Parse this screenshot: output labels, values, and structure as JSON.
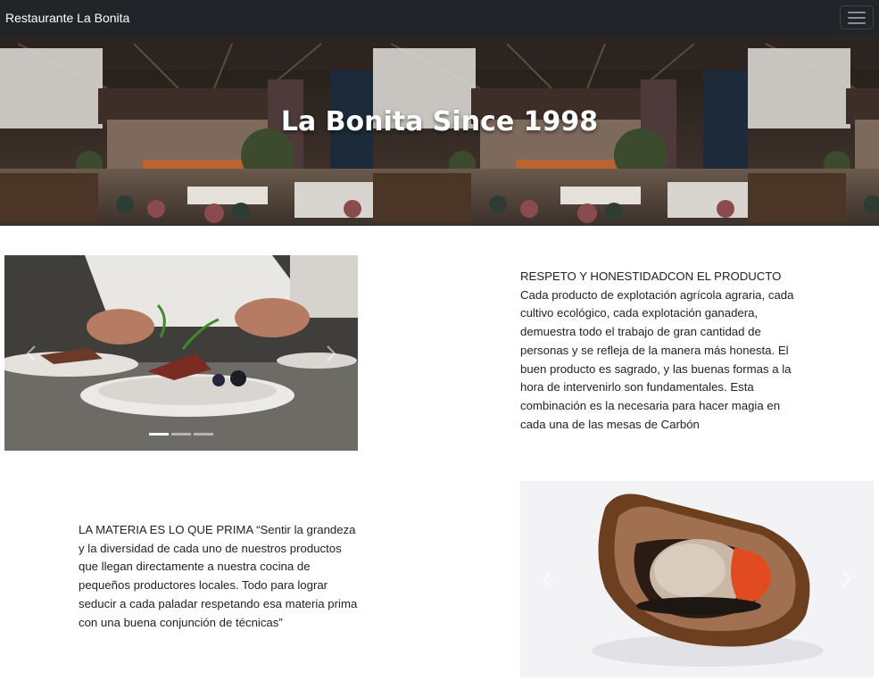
{
  "navbar": {
    "brand": "Restaurante La Bonita",
    "toggler_icon": "hamburger-menu-icon"
  },
  "hero": {
    "title": "La Bonita Since 1998"
  },
  "section1": {
    "carousel": {
      "prev_icon": "chevron-left-icon",
      "next_icon": "chevron-right-icon",
      "indicators": 3,
      "active_index": 0
    },
    "text": "RESPETO Y HONESTIDADCON EL PRODUCTO Cada producto de explotación agrícola agraria, cada cultivo ecológico, cada explotación ganadera, demuestra todo el trabajo de gran cantidad de personas y se refleja de la manera más honesta. El buen producto es sagrado, y las buenas formas a la hora de intervenirlo son fundamentales. Esta combinación es la necesaria para hacer magia en cada una de las mesas de Carbón"
  },
  "section2": {
    "text": "LA MATERIA ES LO QUE PRIMA “Sentir la grandeza y la diversidad de cada uno de nuestros productos que llegan directamente a nuestra cocina de pequeños productores locales. Todo para lograr seducir a cada paladar respetando esa materia prima con una buena conjunción de técnicas”",
    "carousel": {
      "prev_icon": "chevron-left-icon",
      "next_icon": "chevron-right-icon"
    }
  },
  "colors": {
    "navbar_bg": "#212529",
    "text": "#212529",
    "page_bg": "#ffffff"
  }
}
